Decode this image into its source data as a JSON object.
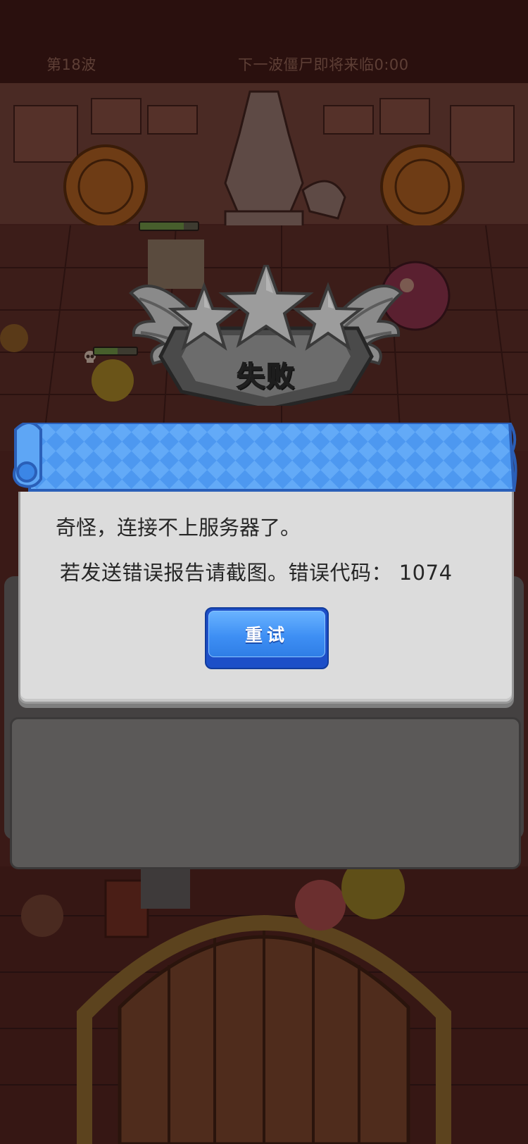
{
  "hud": {
    "wave": "第18波",
    "countdown": "下一波僵尸即将来临0:00"
  },
  "result": {
    "title": "失败",
    "stars_earned": 0,
    "stars_total": 3
  },
  "dialog": {
    "message_line1": "奇怪，连接不上服务器了。",
    "message_line2": "若发送错误报告请截图。错误代码：  1074",
    "retry_label": "重试"
  },
  "colors": {
    "ribbon_blue": "#4d98f0",
    "button_blue": "#3e8ff4",
    "dialog_bg": "#dcdcdc",
    "star_gray": "#8c8c8c"
  }
}
